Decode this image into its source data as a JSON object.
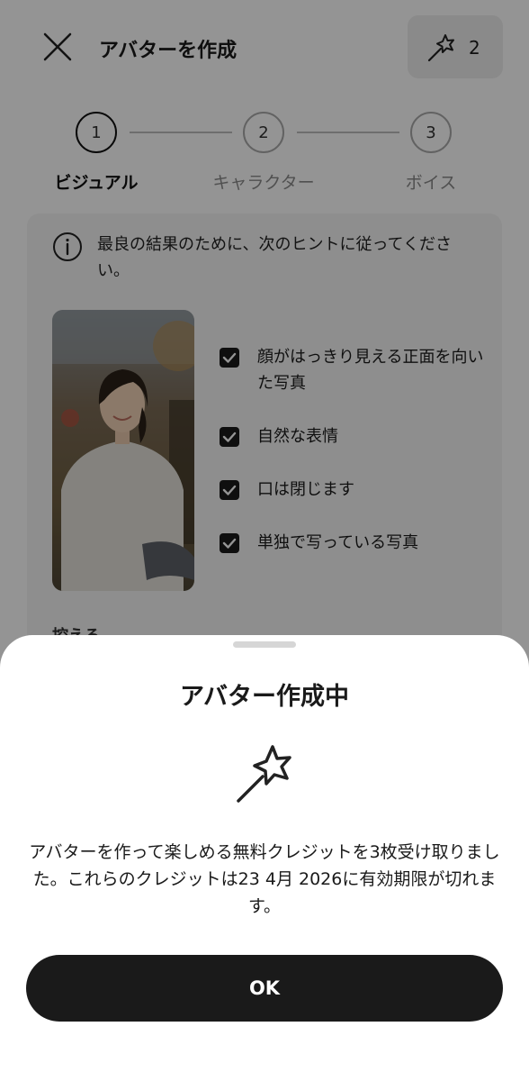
{
  "header": {
    "title": "アバターを作成",
    "credits": "2"
  },
  "stepper": {
    "steps": [
      {
        "number": "1",
        "label": "ビジュアル"
      },
      {
        "number": "2",
        "label": "キャラクター"
      },
      {
        "number": "3",
        "label": "ボイス"
      }
    ],
    "active_step": 1
  },
  "tips": {
    "intro": "最良の結果のために、次のヒントに従ってください。",
    "items": [
      "顔がはっきり見える正面を向いた写真",
      "自然な表情",
      "口は閉じます",
      "単独で写っている写真"
    ],
    "peek": "控える"
  },
  "sheet": {
    "title": "アバター作成中",
    "message": "アバターを作って楽しめる無料クレジットを3枚受け取りました。これらのクレジットは23 4月 2026に有効期限が切れます。",
    "ok_label": "OK"
  },
  "colors": {
    "primary": "#1a1a1a",
    "overlay": "#000000",
    "card_bg": "#f4f4f4"
  }
}
